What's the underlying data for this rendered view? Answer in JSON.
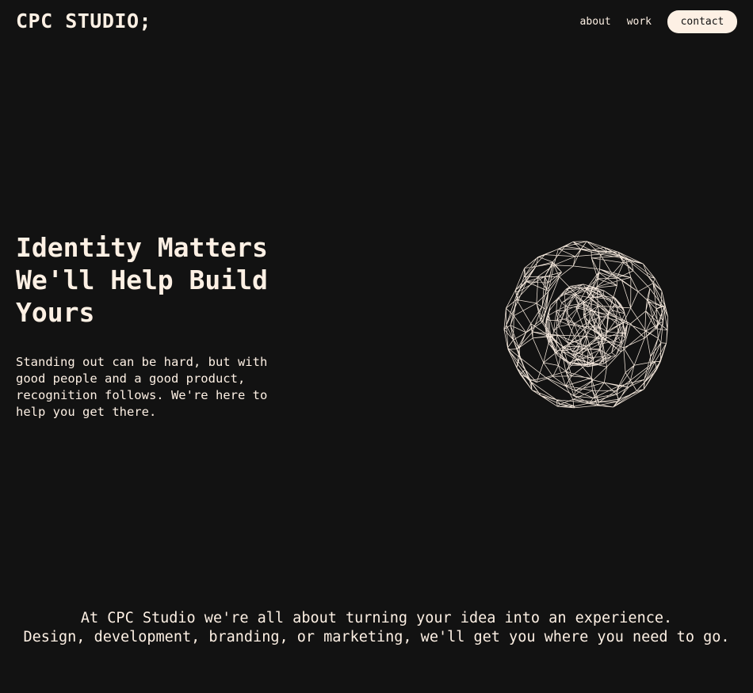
{
  "header": {
    "logo": "CPC STUDIO;",
    "nav": {
      "about": "about",
      "work": "work",
      "contact": "contact"
    }
  },
  "hero": {
    "title_lines": [
      "Identity Matters",
      "We'll Help Build",
      "Yours"
    ],
    "subtitle_lines": [
      "Standing out can be hard, but with",
      "good people and a good product,",
      "recognition follows. We're here to",
      "help you get there."
    ],
    "graphic": {
      "icon": "wireframe-sphere-icon",
      "color": "#fdf0e4"
    }
  },
  "tagline": {
    "lines": [
      "At CPC Studio we're all about turning your idea into an experience.",
      "Design, development, branding, or marketing, we'll get you where you need to go."
    ]
  },
  "colors": {
    "background": "#121212",
    "foreground": "#fdf0e4",
    "button_bg": "#fdf0e4",
    "button_text": "#121212"
  }
}
